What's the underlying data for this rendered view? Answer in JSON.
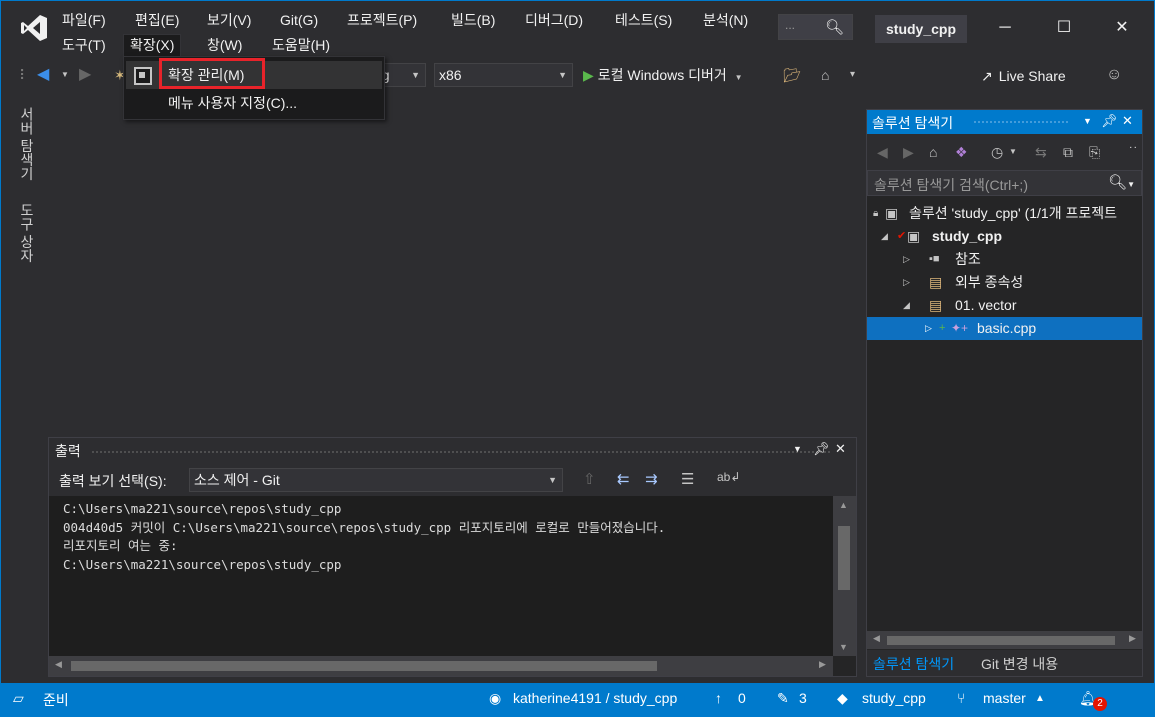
{
  "menu": {
    "items": [
      "파일(F)",
      "편집(E)",
      "보기(V)",
      "Git(G)",
      "프로젝트(P)",
      "빌드(B)",
      "디버그(D)",
      "테스트(S)",
      "분석(N)"
    ],
    "row2": [
      "도구(T)",
      "확장(X)",
      "창(W)",
      "도움말(H)"
    ],
    "search_placeholder": "...",
    "solution_name": "study_cpp"
  },
  "toolbar": {
    "config_combo_tail": "ug",
    "platform_combo": "x86",
    "run_label": "로컬 Windows 디버거",
    "live_share": "Live Share"
  },
  "dropdown": {
    "items": [
      "확장 관리(M)",
      "메뉴 사용자 지정(C)..."
    ]
  },
  "side_tabs": [
    "서버 탐색기",
    "도구 상자"
  ],
  "output": {
    "title": "출력",
    "show_label": "출력 보기 선택(S):",
    "source": "소스 제어 - Git",
    "lines": [
      "C:\\Users\\ma221\\source\\repos\\study_cpp",
      "004d40d5 커밋이 C:\\Users\\ma221\\source\\repos\\study_cpp 리포지토리에 로컬로 만들어졌습니다.",
      "리포지토리 여는 중:",
      "C:\\Users\\ma221\\source\\repos\\study_cpp"
    ]
  },
  "solution_explorer": {
    "title": "솔루션 탐색기",
    "search_placeholder": "솔루션 탐색기 검색(Ctrl+;)",
    "tree": [
      "솔루션 'study_cpp' (1/1개 프로젝트",
      "study_cpp",
      "참조",
      "외부 종속성",
      "01. vector",
      "basic.cpp"
    ],
    "tabs": [
      "솔루션 탐색기",
      "Git 변경 내용"
    ]
  },
  "status": {
    "ready": "준비",
    "repo": "katherine4191 / study_cpp",
    "up_count": "0",
    "edit_count": "3",
    "repo_name": "study_cpp",
    "branch": "master",
    "notifications": "2"
  }
}
